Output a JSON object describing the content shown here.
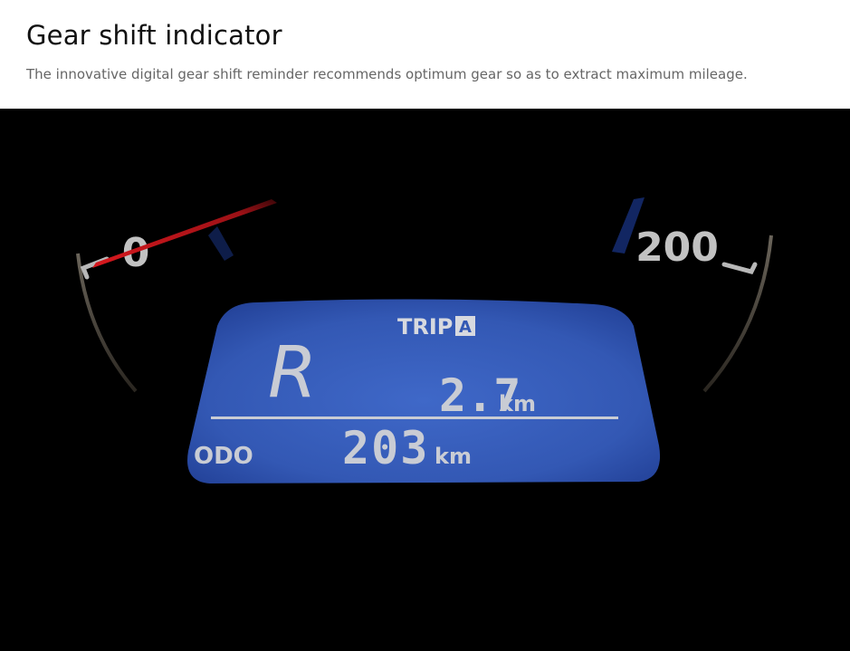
{
  "header": {
    "title": "Gear shift indicator",
    "subtitle": "The innovative digital gear shift reminder recommends optimum gear so as to extract maximum mileage."
  },
  "dashboard": {
    "speed_min_label": "0",
    "speed_max_label": "200",
    "trip_label": "TRIP",
    "trip_badge": "A",
    "gear": "R",
    "trip_value": "2.7",
    "trip_unit": "km",
    "odo_label": "ODO",
    "odo_value": "203",
    "odo_unit": "km",
    "colors": {
      "lcd_blue": "#3b62c0",
      "needle_red": "#c0161c",
      "digit_gray": "#c9ccd4"
    }
  }
}
